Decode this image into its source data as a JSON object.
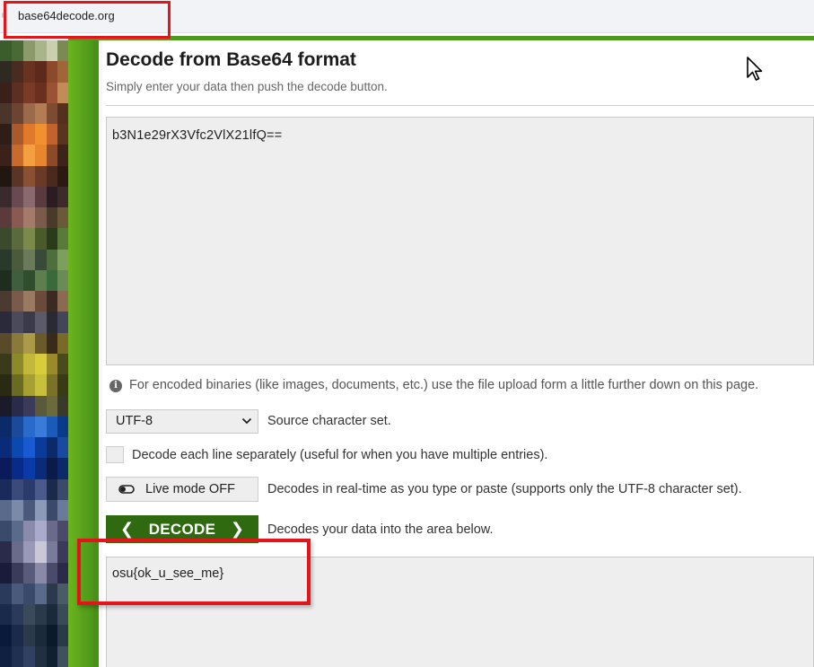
{
  "browser": {
    "url": "base64decode.org"
  },
  "page": {
    "title": "Decode from Base64 format",
    "subtitle": "Simply enter your data then push the decode button."
  },
  "input": {
    "value": "b3N1e29rX3Vfc2VlX21lfQ=="
  },
  "notice": {
    "icon": "info-icon",
    "text": "For encoded binaries (like images, documents, etc.) use the file upload form a little further down on this page."
  },
  "charset": {
    "selected": "UTF-8",
    "label": "Source character set."
  },
  "line_option": {
    "checked": false,
    "label": "Decode each line separately (useful for when you have multiple entries)."
  },
  "live_mode": {
    "button_label": "Live mode OFF",
    "description": "Decodes in real-time as you type or paste (supports only the UTF-8 character set)."
  },
  "decode": {
    "button_label": "DECODE",
    "description": "Decodes your data into the area below."
  },
  "output": {
    "value": "osu{ok_u_see_me}"
  },
  "colors": {
    "brand_green": "#4c9a1d",
    "decode_button": "#2f6a10",
    "annotation_red": "#e3151a",
    "field_bg": "#eeeeee"
  }
}
